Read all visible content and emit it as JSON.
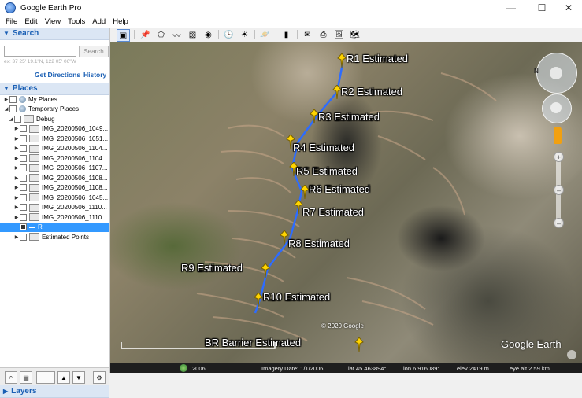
{
  "window": {
    "title": "Google Earth Pro",
    "minimize": "—",
    "maximize": "☐",
    "close": "✕"
  },
  "menu": [
    "File",
    "Edit",
    "View",
    "Tools",
    "Add",
    "Help"
  ],
  "search": {
    "heading": "Search",
    "placeholder": "",
    "button": "Search",
    "coord_hint": "ex: 37 25' 19.1\"N, 122 05' 06\"W",
    "get_directions": "Get Directions",
    "history": "History"
  },
  "places": {
    "heading": "Places",
    "items": [
      {
        "label": "My Places",
        "checked": false
      },
      {
        "label": "Temporary Places",
        "checked": false
      },
      {
        "label": "Debug",
        "checked": false
      },
      {
        "label": "IMG_20200506_1049...",
        "checked": false
      },
      {
        "label": "IMG_20200506_1051...",
        "checked": false
      },
      {
        "label": "IMG_20200506_1104...",
        "checked": false
      },
      {
        "label": "IMG_20200506_1104...",
        "checked": false
      },
      {
        "label": "IMG_20200506_1107...",
        "checked": false
      },
      {
        "label": "IMG_20200506_1108...",
        "checked": false
      },
      {
        "label": "IMG_20200506_1108...",
        "checked": false
      },
      {
        "label": "IMG_20200506_1045...",
        "checked": false
      },
      {
        "label": "IMG_20200506_1110...",
        "checked": false
      },
      {
        "label": "IMG_20200506_1110...",
        "checked": false
      },
      {
        "label": "R",
        "checked": true
      },
      {
        "label": "Estimated Points",
        "checked": false
      }
    ]
  },
  "layers": {
    "heading": "Layers"
  },
  "map": {
    "placemarks": [
      {
        "label": "R1 Estimated"
      },
      {
        "label": "R2 Estimated"
      },
      {
        "label": "R3 Estimated"
      },
      {
        "label": "R4 Estimated"
      },
      {
        "label": "R5 Estimated"
      },
      {
        "label": "R6 Estimated"
      },
      {
        "label": "R7 Estimated"
      },
      {
        "label": "R8 Estimated"
      },
      {
        "label": "R9 Estimated"
      },
      {
        "label": "R10 Estimated"
      },
      {
        "label": "BR Barrier Estimated"
      }
    ],
    "copyright": "© 2020 Google",
    "logo": "Google Earth",
    "year_badge": "2006"
  },
  "status": {
    "imagery_date": "Imagery Date: 1/1/2006",
    "lat": "lat   45.463894°",
    "lon": "lon   6.916089°",
    "elev": "elev  2419 m",
    "eye_alt": "eye alt   2.59 km"
  },
  "colors": {
    "accent": "#1a5fb4",
    "selected": "#3399ff",
    "path": "#2d6cff",
    "pin": "#ffd400"
  }
}
